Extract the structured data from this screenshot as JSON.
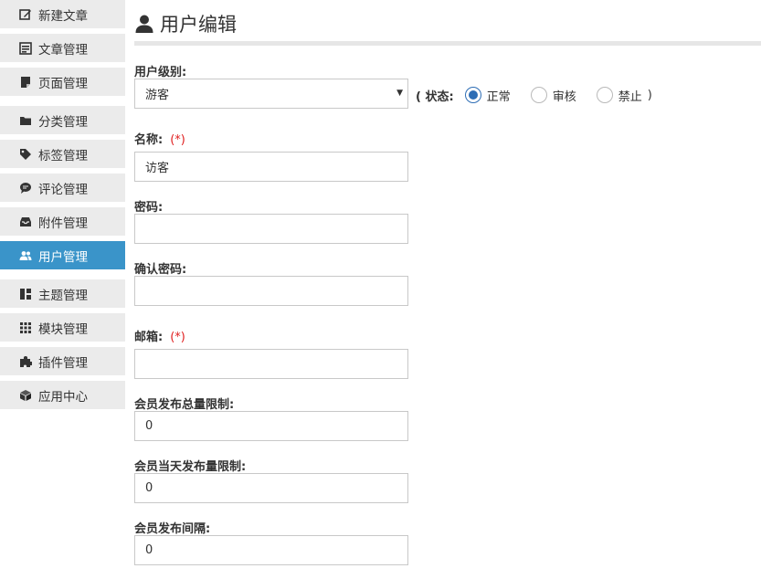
{
  "sidebar": {
    "items": [
      {
        "label": "新建文章",
        "icon": "edit-icon"
      },
      {
        "label": "文章管理",
        "icon": "article-list-icon"
      },
      {
        "label": "页面管理",
        "icon": "page-icon"
      },
      {
        "label": "分类管理",
        "icon": "folder-icon"
      },
      {
        "label": "标签管理",
        "icon": "tag-icon"
      },
      {
        "label": "评论管理",
        "icon": "comment-icon"
      },
      {
        "label": "附件管理",
        "icon": "inbox-icon"
      },
      {
        "label": "用户管理",
        "icon": "users-icon",
        "active": true
      },
      {
        "label": "主题管理",
        "icon": "theme-layout-icon"
      },
      {
        "label": "模块管理",
        "icon": "grid-icon"
      },
      {
        "label": "插件管理",
        "icon": "puzzle-icon"
      },
      {
        "label": "应用中心",
        "icon": "cube-icon"
      }
    ]
  },
  "page": {
    "title": "用户编辑",
    "title_icon": "user-icon"
  },
  "form": {
    "level": {
      "label": "用户级别:",
      "value": "游客"
    },
    "status": {
      "lead": "( 状态:",
      "options": [
        "正常",
        "审核",
        "禁止"
      ],
      "selected": "正常",
      "close": ")"
    },
    "name": {
      "label": "名称:",
      "required": "(*)",
      "value": "访客"
    },
    "password": {
      "label": "密码:",
      "value": ""
    },
    "confirm_password": {
      "label": "确认密码:",
      "value": ""
    },
    "email": {
      "label": "邮箱:",
      "required": "(*)",
      "value": ""
    },
    "total_post_limit": {
      "label": "会员发布总量限制:",
      "value": "0"
    },
    "daily_post_limit": {
      "label": "会员当天发布量限制:",
      "value": "0"
    },
    "post_interval": {
      "label": "会员发布间隔:",
      "value": "0"
    }
  },
  "colors": {
    "active_nav": "#3a94c9",
    "radio_selected": "#2d6db5",
    "required": "#e02020"
  }
}
